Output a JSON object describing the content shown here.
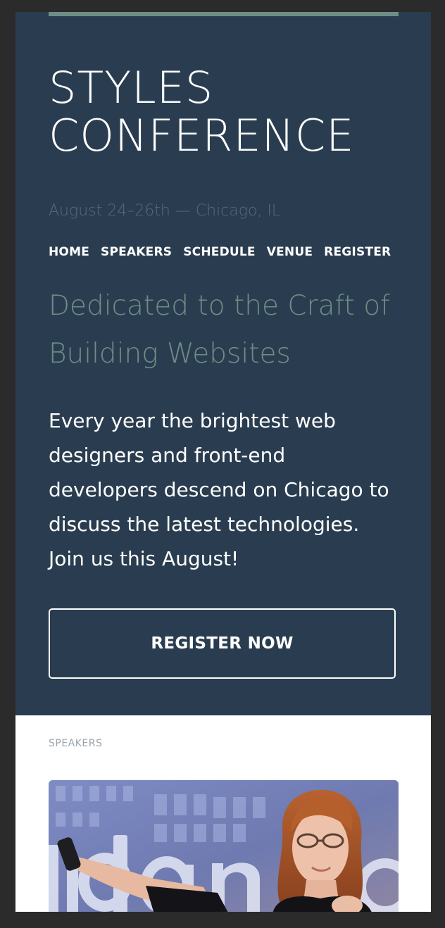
{
  "hero": {
    "title_line1": "STYLES",
    "title_line2": "CONFERENCE",
    "date_location": "August 24–26th — Chicago, IL",
    "tagline_line1": "Dedicated to the Craft of",
    "tagline_line2": "Building Websites",
    "intro_lines": [
      "Every year the brightest web",
      "designers and front-end",
      "developers descend on Chicago to",
      "discuss the latest technologies.",
      "Join us this August!"
    ],
    "cta_label": "REGISTER NOW"
  },
  "nav": {
    "items": [
      "HOME",
      "SPEAKERS",
      "SCHEDULE",
      "VENUE",
      "REGISTER"
    ]
  },
  "speakers": {
    "section_label": "SPEAKERS"
  },
  "colors": {
    "hero_bg": "#2a3d50",
    "accent": "#6f8d86",
    "outer_bg": "#2b2b2b",
    "date_text": "#58697b",
    "section_label": "#9aa5ae"
  }
}
